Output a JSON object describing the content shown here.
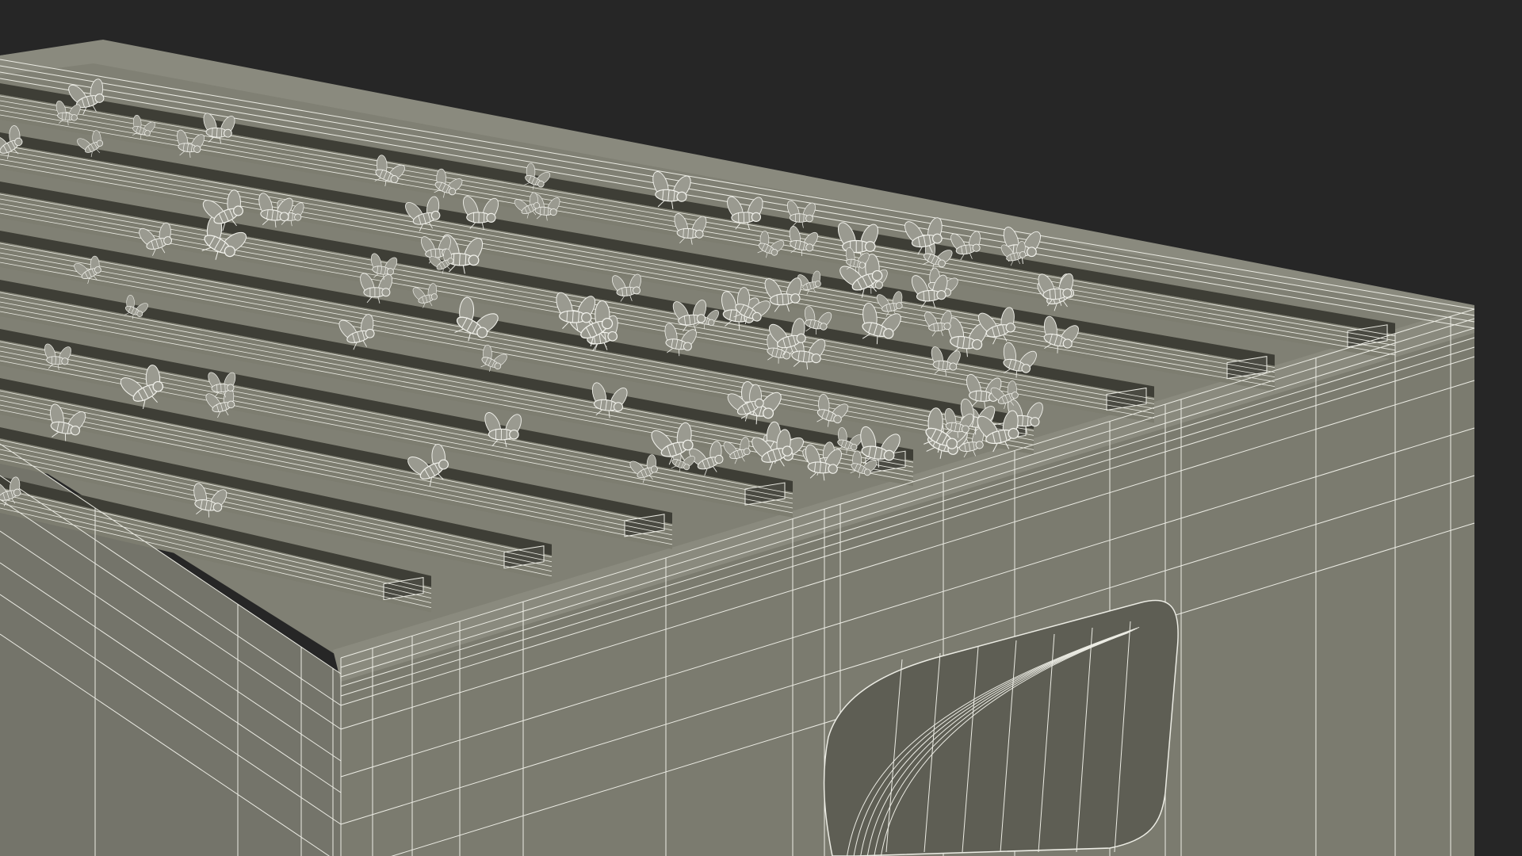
{
  "scene": {
    "subject": "beehive-wireframe-render",
    "colors": {
      "background": "#262626",
      "body": "#7d7d70",
      "body_dark": "#6a6a5e",
      "body_shadow": "#56564c",
      "slot": "#3e3e36",
      "slot_floor": "#4a4a42",
      "wire": "#ecece4",
      "bee_fill": "#9a9a90",
      "bee_wire": "#f2f2ec"
    },
    "icons": {
      "bee": "bee-icon",
      "handle": "handle-cutout-icon"
    },
    "frame_count": 9,
    "bee_count": 110
  }
}
